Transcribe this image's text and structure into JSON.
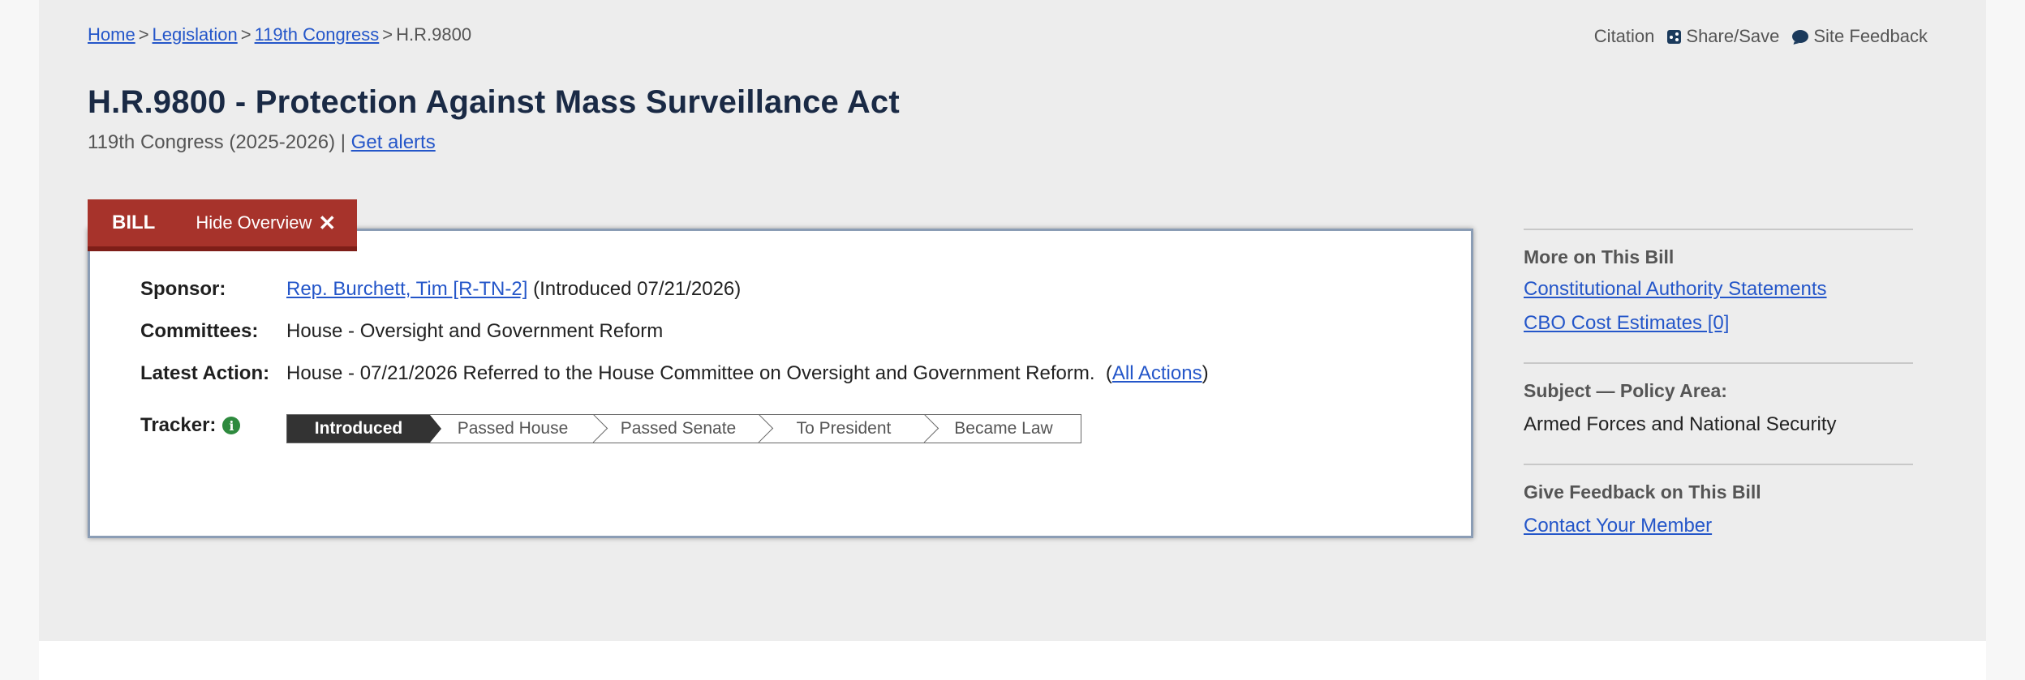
{
  "breadcrumb": {
    "items": [
      "Home",
      "Legislation",
      "119th Congress"
    ],
    "current": "H.R.9800",
    "separator": ">"
  },
  "top_links": {
    "citation": "Citation",
    "share_save": "Share/Save",
    "site_feedback": "Site Feedback"
  },
  "bill": {
    "title": "H.R.9800 - Protection Against Mass Surveillance Act",
    "congress": "119th Congress (2025-2026) |",
    "get_alerts": "Get alerts"
  },
  "tabs": {
    "bill": "BILL",
    "hide_overview": "Hide Overview"
  },
  "overview": {
    "sponsor_label": "Sponsor:",
    "sponsor_name": "Rep. Burchett, Tim [R-TN-2]",
    "sponsor_intro": "(Introduced 07/21/2026)",
    "committees_label": "Committees:",
    "committees_value": "House - Oversight and Government Reform",
    "latest_action_label": "Latest Action:",
    "latest_action_value": "House - 07/21/2026 Referred to the House Committee on Oversight and Government Reform.",
    "all_actions_open": "(",
    "all_actions": "All Actions",
    "all_actions_close": ")",
    "tracker_label": "Tracker:",
    "tracker_steps": [
      "Introduced",
      "Passed House",
      "Passed Senate",
      "To President",
      "Became Law"
    ],
    "tracker_active_step": "Introduced"
  },
  "sidebar": {
    "more_heading": "More on This Bill",
    "more_links": [
      "Constitutional Authority Statements",
      "CBO Cost Estimates [0]"
    ],
    "subject_heading": "Subject — Policy Area:",
    "subject_value": "Armed Forces and National Security",
    "feedback_heading": "Give Feedback on This Bill",
    "feedback_link": "Contact Your Member"
  },
  "colors": {
    "tab_red": "#a7332b",
    "link_blue": "#2456c9",
    "title_navy": "#1a2a45",
    "tracker_active": "#333333",
    "info_green": "#2e8a3e"
  }
}
